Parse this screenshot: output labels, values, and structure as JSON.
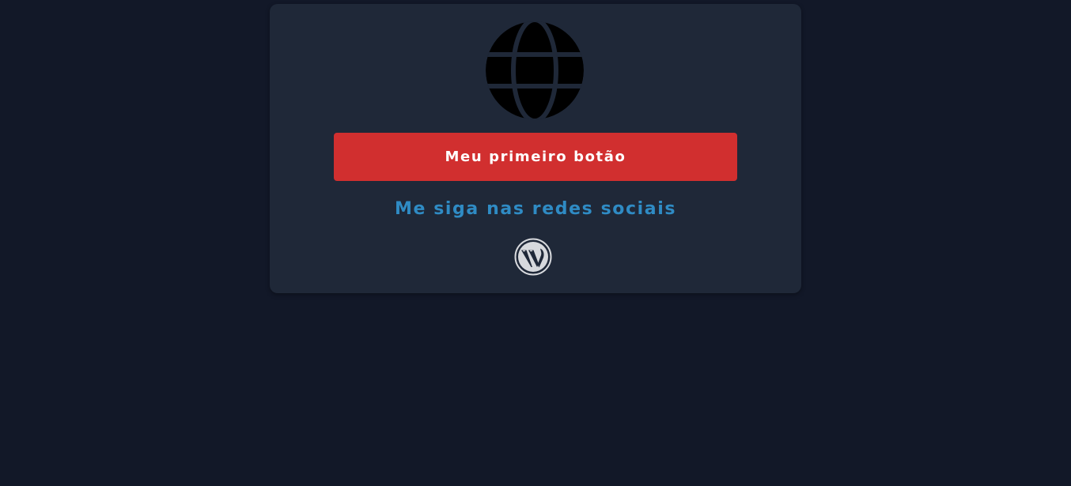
{
  "card": {
    "primary_button_label": "Meu primeiro botão",
    "social_heading": "Me siga nas redes sociais"
  },
  "icons": {
    "globe": "globe-icon",
    "social": "wordpress-icon"
  },
  "colors": {
    "page_background": "#121828",
    "card_background": "#1f2838",
    "button_background": "#d12f2f",
    "button_text": "#ffffff",
    "heading_text": "#2f8bc4",
    "globe": "#000000",
    "wordpress_icon": "#d7d9dd"
  }
}
